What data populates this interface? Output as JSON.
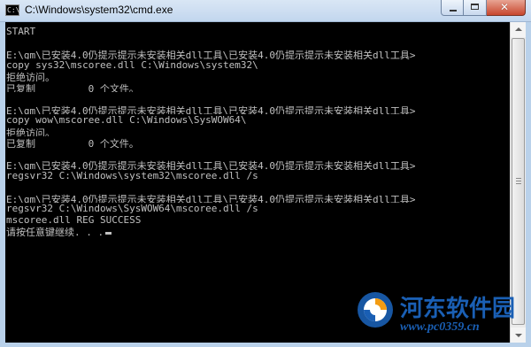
{
  "window": {
    "title": "C:\\Windows\\system32\\cmd.exe",
    "icon_text": "C:\\"
  },
  "console": {
    "lines": [
      "START",
      "",
      "E:\\gm\\已安装4.0仍提示提示未安装相关dll工具\\已安装4.0仍提示提示未安装相关dll工具>",
      "copy sys32\\mscoree.dll C:\\Windows\\system32\\",
      "拒绝访问。",
      "已复制         0 个文件。",
      "",
      "E:\\gm\\已安装4.0仍提示提示未安装相关dll工具\\已安装4.0仍提示提示未安装相关dll工具>",
      "copy wow\\mscoree.dll C:\\Windows\\SysWOW64\\",
      "拒绝访问。",
      "已复制         0 个文件。",
      "",
      "E:\\gm\\已安装4.0仍提示提示未安装相关dll工具\\已安装4.0仍提示提示未安装相关dll工具>",
      "regsvr32 C:\\Windows\\system32\\mscoree.dll /s",
      "",
      "E:\\gm\\已安装4.0仍提示提示未安装相关dll工具\\已安装4.0仍提示提示未安装相关dll工具>",
      "regsvr32 C:\\Windows\\SysWOW64\\mscoree.dll /s",
      "mscoree.dll REG SUCCESS",
      "请按任意键继续. . ."
    ]
  },
  "watermark": {
    "name": "河东软件园",
    "url": "www.pc0359.cn"
  },
  "colors": {
    "console_bg": "#000000",
    "console_fg": "#c0c0c0",
    "watermark": "#1a5fb4"
  }
}
